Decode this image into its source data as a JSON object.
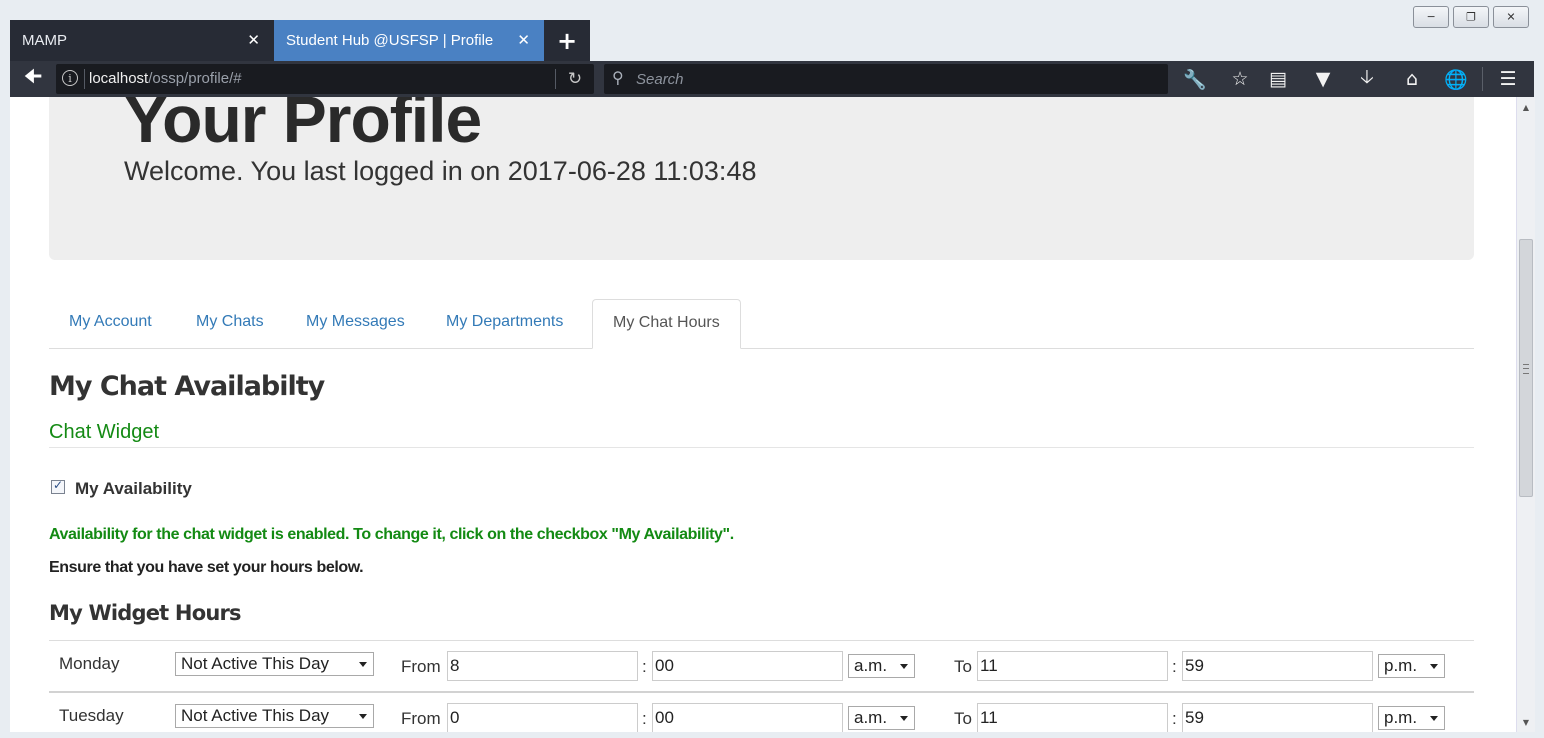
{
  "window": {
    "controls": [
      "minimize",
      "restore",
      "close"
    ]
  },
  "browser": {
    "tabs": [
      {
        "label": "MAMP",
        "active": false
      },
      {
        "label": "Student Hub @USFSP | Profile",
        "active": true
      }
    ],
    "url_host": "localhost",
    "url_path": "/ossp/profile/#",
    "search_placeholder": "Search",
    "toolbar_icons": [
      "wrench-icon",
      "star-icon",
      "reading-list-icon",
      "pocket-icon",
      "download-icon",
      "home-icon",
      "globe-icon",
      "menu-icon"
    ]
  },
  "page": {
    "title": "Your Profile",
    "welcome": "Welcome. You last logged in on 2017-06-28 11:03:48",
    "tabs": [
      {
        "label": "My Account",
        "active": false
      },
      {
        "label": "My Chats",
        "active": false
      },
      {
        "label": "My Messages",
        "active": false
      },
      {
        "label": "My Departments",
        "active": false
      },
      {
        "label": "My Chat Hours",
        "active": true
      }
    ],
    "heading": "My Chat Availabilty",
    "subheading": "Chat Widget",
    "availability_label": "My Availability",
    "availability_checked": true,
    "msg_enabled": "Availability for the chat widget is enabled. To change it, click on the checkbox \"My Availability\".",
    "msg_ensure": "Ensure that you have set your hours below.",
    "hours_heading": "My Widget Hours",
    "from_label": "From",
    "to_label": "To",
    "colon": ":",
    "days": [
      {
        "day": "Monday",
        "status": "Not Active This Day",
        "from_hour": "8",
        "from_min": "00",
        "from_ampm": "a.m.",
        "to_hour": "11",
        "to_min": "59",
        "to_ampm": "p.m."
      },
      {
        "day": "Tuesday",
        "status": "Not Active This Day",
        "from_hour": "0",
        "from_min": "00",
        "from_ampm": "a.m.",
        "to_hour": "11",
        "to_min": "59",
        "to_ampm": "p.m."
      }
    ]
  }
}
